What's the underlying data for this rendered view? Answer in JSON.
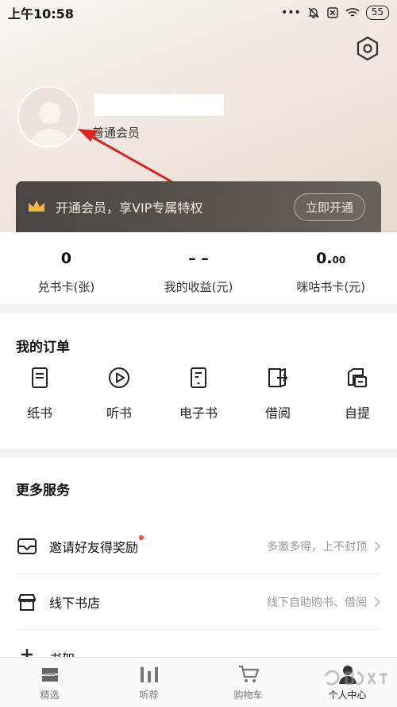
{
  "status_bar": {
    "time": "上午10:58",
    "battery": "55"
  },
  "profile": {
    "member_level": "普通会员"
  },
  "vip_banner": {
    "text": "开通会员，享VIP专属特权",
    "button": "立即开通"
  },
  "stats": [
    {
      "value": "0",
      "label": "兑书卡(张)"
    },
    {
      "value": "– –",
      "label": "我的收益(元)"
    },
    {
      "value": "0.",
      "value_small": "00",
      "label": "咪咕书卡(元)"
    }
  ],
  "orders": {
    "title": "我的订单",
    "items": [
      {
        "label": "纸书",
        "icon": "paper-book-icon"
      },
      {
        "label": "听书",
        "icon": "play-circle-icon"
      },
      {
        "label": "电子书",
        "icon": "ebook-icon"
      },
      {
        "label": "借阅",
        "icon": "borrow-book-icon"
      },
      {
        "label": "自提",
        "icon": "pickup-icon"
      }
    ]
  },
  "services": {
    "title": "更多服务",
    "items": [
      {
        "label": "邀请好友得奖励",
        "desc": "多邀多得，上不封顶",
        "icon": "mail-icon",
        "has_dot": true
      },
      {
        "label": "线下书店",
        "desc": "线下自助购书、借阅",
        "icon": "store-icon",
        "has_dot": false
      },
      {
        "label": "书架",
        "desc": "",
        "icon": "shelf-icon",
        "has_dot": false
      }
    ]
  },
  "tabs": [
    {
      "label": "精选",
      "icon": "featured-icon"
    },
    {
      "label": "听荐",
      "icon": "audio-bars-icon"
    },
    {
      "label": "购物车",
      "icon": "cart-icon"
    },
    {
      "label": "个人中心",
      "icon": "user-center-icon",
      "active": true
    }
  ],
  "colors": {
    "accent_red": "#e8513d",
    "banner_dark": "#4a4542",
    "arrow": "#e02020"
  }
}
